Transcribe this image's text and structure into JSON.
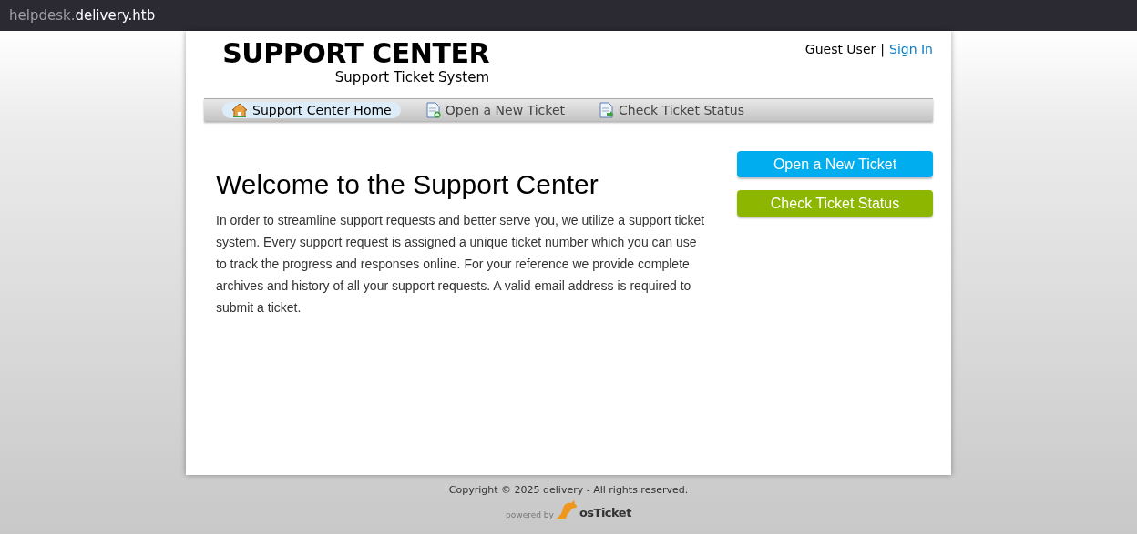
{
  "address_bar": {
    "url_prefix": "helpdesk.",
    "url_domain": "delivery.htb"
  },
  "header": {
    "logo_title": "SUPPORT CENTER",
    "logo_subtitle": "Support Ticket System",
    "user": "Guest User",
    "separator": "|",
    "sign_in": "Sign In"
  },
  "nav": [
    {
      "label": "Support Center Home",
      "kind": "home",
      "selected": true
    },
    {
      "label": "Open a New Ticket",
      "kind": "new",
      "selected": false
    },
    {
      "label": "Check Ticket Status",
      "kind": "status",
      "selected": false
    }
  ],
  "welcome": {
    "title": "Welcome to the Support Center",
    "body": "In order to streamline support requests and better serve you, we utilize a support ticket system. Every support request is assigned a unique ticket number which you can use to track the progress and responses online. For your reference we provide complete archives and history of all your support requests. A valid email address is required to submit a ticket."
  },
  "actions": [
    {
      "label": "Open a New Ticket",
      "color": "#00aeef"
    },
    {
      "label": "Check Ticket Status",
      "color": "#8db600"
    }
  ],
  "footer": {
    "copyright": "Copyright © 2025 delivery - All rights reserved.",
    "powered_by": "powered by",
    "brand": "osTicket"
  }
}
